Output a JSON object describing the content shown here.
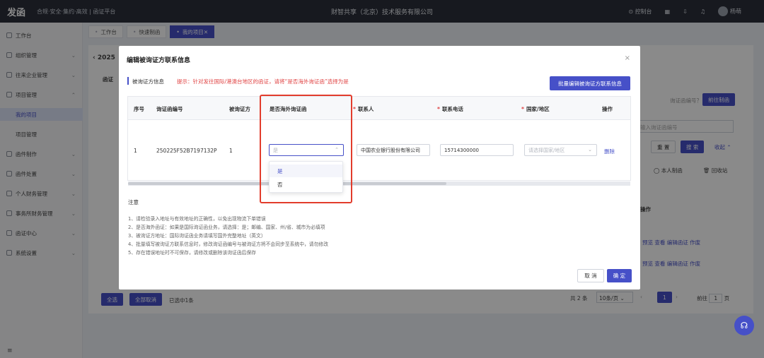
{
  "topbar": {
    "logo": "发函",
    "slogan": "合规·安全·集约·高效 | 函证平台",
    "company": "财智共享（北京）技术服务有限公司",
    "console": "控制台",
    "user": "杨萌"
  },
  "sidebar": {
    "items": [
      {
        "label": "工作台",
        "icon": "home-icon"
      },
      {
        "label": "组织管理",
        "icon": "org-icon"
      },
      {
        "label": "往来企业管理",
        "icon": "company-icon"
      },
      {
        "label": "项目管理",
        "icon": "project-icon"
      },
      {
        "label": "我的项目"
      },
      {
        "label": "项目管理"
      },
      {
        "label": "函件制作",
        "icon": "edit-icon"
      },
      {
        "label": "函件处置",
        "icon": "file-icon"
      },
      {
        "label": "个人财务管理",
        "icon": "finance-icon"
      },
      {
        "label": "事务所财务管理",
        "icon": "bank-icon"
      },
      {
        "label": "函证中心",
        "icon": "center-icon"
      },
      {
        "label": "系统设置",
        "icon": "gear-icon"
      }
    ]
  },
  "tabs": [
    "工作台",
    "快速制函",
    "我的项目"
  ],
  "background": {
    "year": "2025",
    "section": "函证",
    "confirm_no_label": "询证函编号？",
    "go_make": "前往制函",
    "search_placeholder": "输入询证函编号",
    "reset": "重 置",
    "search": "搜 索",
    "collapse": "收起",
    "self_made": "本人制函",
    "recycle": "回收站",
    "op": "操作",
    "row_actions": "预览  查看  编辑函证  作废",
    "select_all": "全选",
    "cancel_all": "全部取消",
    "selected": "已选中1条",
    "total": "共 2 条",
    "page_size": "10条/页",
    "page": "1",
    "goto": "前往",
    "page_unit": "页"
  },
  "modal": {
    "title": "编辑被询证方联系信息",
    "section_title": "被询证方信息",
    "hint": "提示：针对发往国际/港澳台地区的函证，请将“是否海外询证函”选择为是",
    "batch_button": "批量编辑被询证方联系信息",
    "columns": [
      "序号",
      "询证函编号",
      "被询证方",
      "是否海外询证函",
      "联系人",
      "联系电话",
      "国家/地区",
      "操作"
    ],
    "row": {
      "index": "1",
      "number": "250225F52B7197132P",
      "party": "1",
      "overseas_placeholder": "是",
      "contact": "中国农业银行股份有限公司",
      "phone": "15714300000",
      "country_placeholder": "请选择国家/地区",
      "action": "删除"
    },
    "dropdown_options": [
      "是",
      "否"
    ],
    "notes_title": "注意",
    "notes": [
      "1、请检验录入地址与有效地址的正确性，以免出现物流下单错误",
      "2、是否海外函证：如果是国际询证函业务，请选择：是；邮编、国家、州/省、城市为必填项",
      "3、被询证方地址：国际询证函业务请填写国外完整地址（英文）",
      "4、批量填写被询证方联系信息时，修改询证函编号与被询证方将不会同步至系统中，请勿修改",
      "5、存在错误地址时不可保存，请修改或删除该询证函后保存"
    ],
    "cancel": "取 消",
    "ok": "确 定"
  },
  "colors": {
    "accent": "#4650c8",
    "highlight": "#e23c2c",
    "warning": "#e04444"
  }
}
